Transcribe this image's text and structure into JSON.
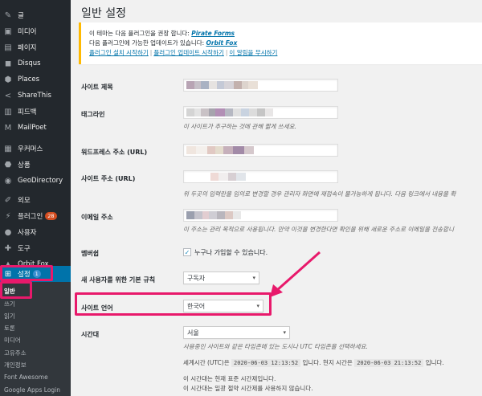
{
  "sidebar": {
    "items": [
      {
        "label": "글",
        "icon": "pin-icon"
      },
      {
        "label": "미디어",
        "icon": "media-icon"
      },
      {
        "label": "페이지",
        "icon": "page-icon"
      },
      {
        "label": "Disqus",
        "icon": "comments-icon"
      },
      {
        "label": "Places",
        "icon": "location-icon"
      },
      {
        "label": "ShareThis",
        "icon": "share-icon"
      },
      {
        "label": "피드백",
        "icon": "feedback-icon"
      },
      {
        "label": "MailPoet",
        "icon": "mail-icon"
      },
      {
        "label": "우커머스",
        "icon": "woocommerce-icon"
      },
      {
        "label": "상품",
        "icon": "archive-icon"
      },
      {
        "label": "GeoDirectory",
        "icon": "globe-icon"
      },
      {
        "label": "외모",
        "icon": "appearance-icon"
      },
      {
        "label": "플러그인",
        "icon": "plugin-icon",
        "badge": "28"
      },
      {
        "label": "사용자",
        "icon": "users-icon"
      },
      {
        "label": "도구",
        "icon": "tools-icon"
      },
      {
        "label": "Orbit Fox",
        "icon": "fox-icon"
      },
      {
        "label": "설정",
        "icon": "settings-icon",
        "badge": "1"
      }
    ],
    "submenu": [
      "일반",
      "쓰기",
      "읽기",
      "토론",
      "미디어",
      "고유주소",
      "개인정보",
      "Font Awesome",
      "Google Apps Login"
    ]
  },
  "page": {
    "title": "일반 설정",
    "notice": {
      "line1_prefix": "이 테마는 다음 플러그인을 권장 합니다: ",
      "line1_link": "Pirate Forms",
      "line2_prefix": "다음 플러그인에 가능한 업데이트가 있습니다: ",
      "line2_link": "Orbit Fox",
      "links": [
        "플러그인 설치 시작하기",
        "플러그인 업데이트 시작하기",
        "이 알림을 무시하기"
      ],
      "separator": "|"
    },
    "fields": {
      "site_title_label": "사이트 제목",
      "tagline_label": "태그라인",
      "tagline_desc": "이 사이트가 추구하는 것에 관해 짧게 쓰세요.",
      "wp_address_label": "워드프레스 주소 (URL)",
      "site_address_label": "사이트 주소 (URL)",
      "site_address_desc": "위 두곳의 입력란을 임의로 변경할 경우 관리자 화면에 재접속이 불가능하게 됩니다. 다음 링크에서 내용을 확",
      "email_label": "이메일 주소",
      "email_desc": "이 주소는 관리 목적으로 사용됩니다. 만약 이것을 변경한다면 확인을 위해 새로운 주소로 이메일을 전송합니",
      "membership_label": "멤버쉽",
      "membership_checkbox": "누구나 가입할 수 있습니다.",
      "default_role_label": "새 사용자를 위한 기본 규칙",
      "default_role_value": "구독자",
      "site_language_label": "사이트 언어",
      "site_language_value": "한국어",
      "timezone_label": "시간대",
      "timezone_value": "서울",
      "timezone_desc": "사용중인 사이트와 같은 타임존에 있는 도시나 UTC 타임존을 선택하세요.",
      "utc_prefix": "세계시간 (UTC)은",
      "utc_value": "2020-06-03 12:13:52",
      "utc_mid": "입니다. 현지 시간은",
      "local_value": "2020-06-03 21:13:52",
      "local_suffix": "입니다.",
      "std_time": "이 시간대는 현재 표준 시간제입니다.",
      "no_dst": "이 시간대는 일광 절약 시간제를 사용하지 않습니다."
    }
  },
  "colors": {
    "highlight": "#e8196b",
    "sidebar_bg": "#23282d",
    "active_bg": "#0073aa",
    "link": "#0073aa"
  }
}
